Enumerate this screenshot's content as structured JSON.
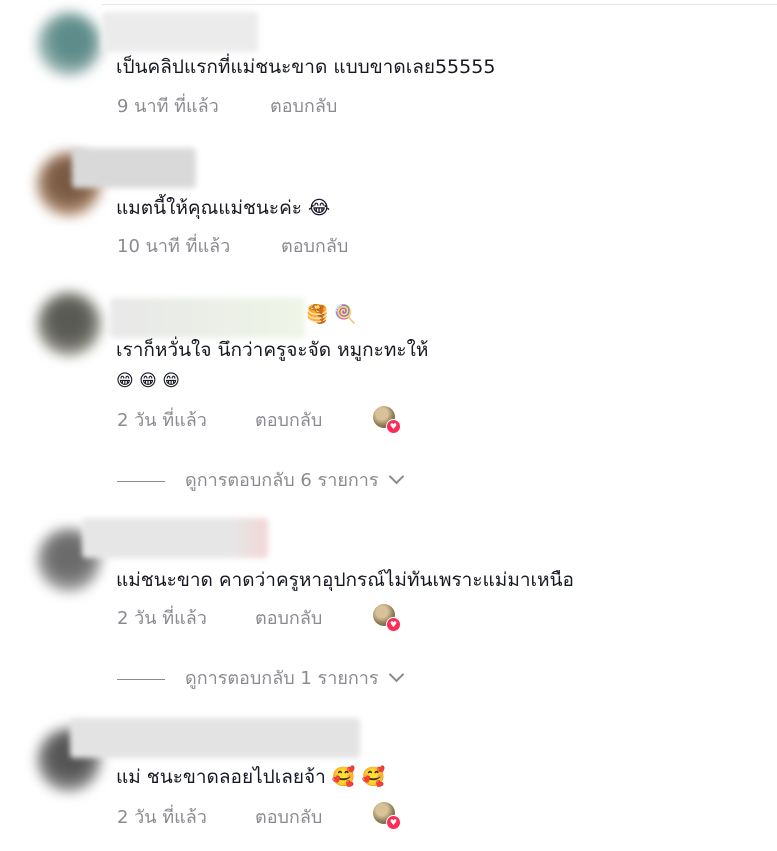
{
  "comments": [
    {
      "text": "เป็นคลิปแรกที่แม่ชนะขาด แบบขาดเลย55555",
      "time": "9 นาที ที่แล้ว",
      "reply_label": "ตอบกลับ"
    },
    {
      "text": "แมตนี้ให้คุณแม่ชนะค่ะ 😂",
      "time": "10 นาที ที่แล้ว",
      "reply_label": "ตอบกลับ"
    },
    {
      "name_emojis": "🥞 🍭",
      "text": "เราก็หวั่นใจ นึกว่าครูจะจัด หมูกะทะให้",
      "text_line2": "😁 😁 😁",
      "time": "2 วัน ที่แล้ว",
      "reply_label": "ตอบกลับ",
      "view_replies": "ดูการตอบกลับ 6 รายการ"
    },
    {
      "text": "แม่ชนะขาด คาดว่าครูหาอุปกรณ์ไม่ทันเพราะแม่มาเหนือ",
      "time": "2 วัน ที่แล้ว",
      "reply_label": "ตอบกลับ",
      "view_replies": "ดูการตอบกลับ 1 รายการ"
    },
    {
      "text": "แม่ ชนะขาดลอยไปเลยจ้า 🥰 🥰",
      "time": "2 วัน ที่แล้ว",
      "reply_label": "ตอบกลับ"
    }
  ],
  "colors": {
    "text": "#161823",
    "meta": "#8a8b91",
    "like_heart": "#fe2c55"
  }
}
